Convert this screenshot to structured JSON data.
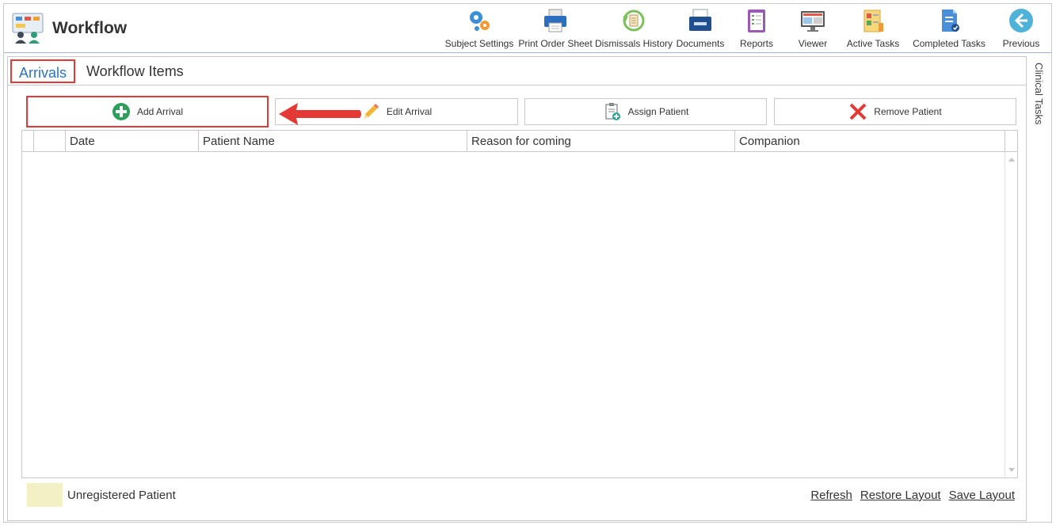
{
  "app": {
    "title": "Workflow",
    "icon": "workflow-icon"
  },
  "toolbar": {
    "items": [
      {
        "label": "Subject Settings",
        "icon": "gears-icon"
      },
      {
        "label": "Print Order Sheet",
        "icon": "printer-icon"
      },
      {
        "label": "Dismissals History",
        "icon": "history-icon"
      },
      {
        "label": "Documents",
        "icon": "document-tray-icon"
      },
      {
        "label": "Reports",
        "icon": "clipboard-icon"
      },
      {
        "label": "Viewer",
        "icon": "monitor-icon"
      },
      {
        "label": "Active Tasks",
        "icon": "active-tasks-icon"
      },
      {
        "label": "Completed Tasks",
        "icon": "completed-tasks-icon"
      },
      {
        "label": "Previous",
        "icon": "back-arrow-icon"
      }
    ]
  },
  "side_panel": {
    "label": "Clinical Tasks"
  },
  "tabs": [
    {
      "label": "Arrivals",
      "selected": true
    },
    {
      "label": "Workflow Items",
      "selected": false
    }
  ],
  "actions": {
    "add": {
      "label": "Add Arrival",
      "icon": "plus-circle-icon"
    },
    "edit": {
      "label": "Edit Arrival",
      "icon": "pencil-icon"
    },
    "assign": {
      "label": "Assign Patient",
      "icon": "assign-patient-icon"
    },
    "remove": {
      "label": "Remove Patient",
      "icon": "red-x-icon"
    }
  },
  "grid": {
    "columns": [
      "Date",
      "Patient Name",
      "Reason for coming",
      "Companion"
    ],
    "rows": []
  },
  "legend": {
    "label": "Unregistered Patient",
    "color": "#f2f0c4"
  },
  "footer_links": {
    "refresh": "Refresh",
    "restore": "Restore Layout",
    "save": "Save Layout"
  },
  "colors": {
    "accent": "#2b73c2",
    "highlight": "#e53935"
  }
}
